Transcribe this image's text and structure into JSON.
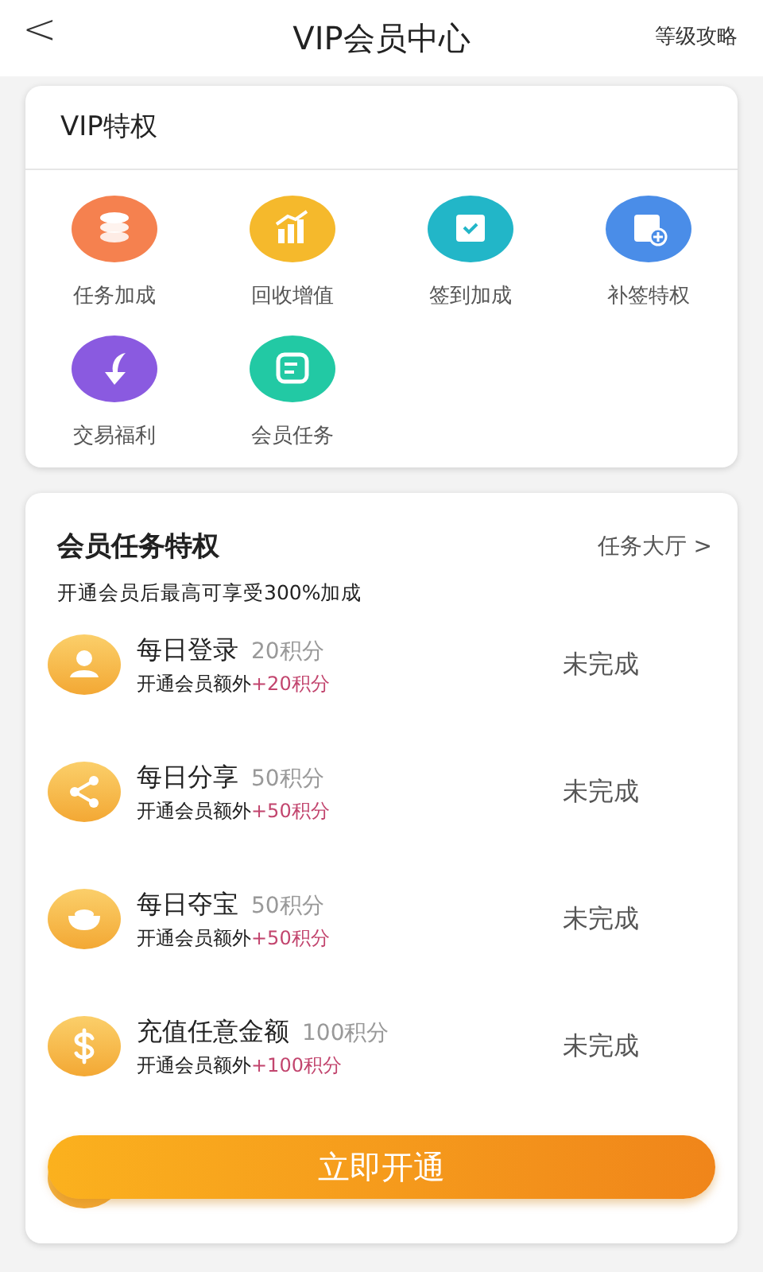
{
  "header": {
    "back": "<",
    "title": "VIP会员中心",
    "action": "等级攻略"
  },
  "privileges": {
    "title": "VIP特权",
    "items": [
      {
        "label": "任务加成",
        "kind": "coins",
        "color": "#f5814f"
      },
      {
        "label": "回收增值",
        "kind": "chart",
        "color": "#f5b92c"
      },
      {
        "label": "签到加成",
        "kind": "calendar",
        "color": "#22b6c8"
      },
      {
        "label": "补签特权",
        "kind": "calendar-plus",
        "color": "#4a8de8"
      },
      {
        "label": "交易福利",
        "kind": "arrow",
        "color": "#8a5ae0"
      },
      {
        "label": "会员任务",
        "kind": "note",
        "color": "#22c9a4"
      }
    ]
  },
  "tasks": {
    "title": "会员任务特权",
    "link": "任务大厅 >",
    "subtitle": "开通会员后最高可享受300%加成",
    "items": [
      {
        "kind": "user",
        "name": "每日登录",
        "points": "20积分",
        "extra_label": "开通会员额外",
        "extra_points": "+20积分",
        "status": "未完成"
      },
      {
        "kind": "share",
        "name": "每日分享",
        "points": "50积分",
        "extra_label": "开通会员额外",
        "extra_points": "+50积分",
        "status": "未完成"
      },
      {
        "kind": "ingot",
        "name": "每日夺宝",
        "points": "50积分",
        "extra_label": "开通会员额外",
        "extra_points": "+50积分",
        "status": "未完成"
      },
      {
        "kind": "dollar",
        "name": "充值任意金额",
        "points": "100积分",
        "extra_label": "开通会员额外",
        "extra_points": "+100积分",
        "status": "未完成"
      }
    ]
  },
  "open_button": "立即开通"
}
